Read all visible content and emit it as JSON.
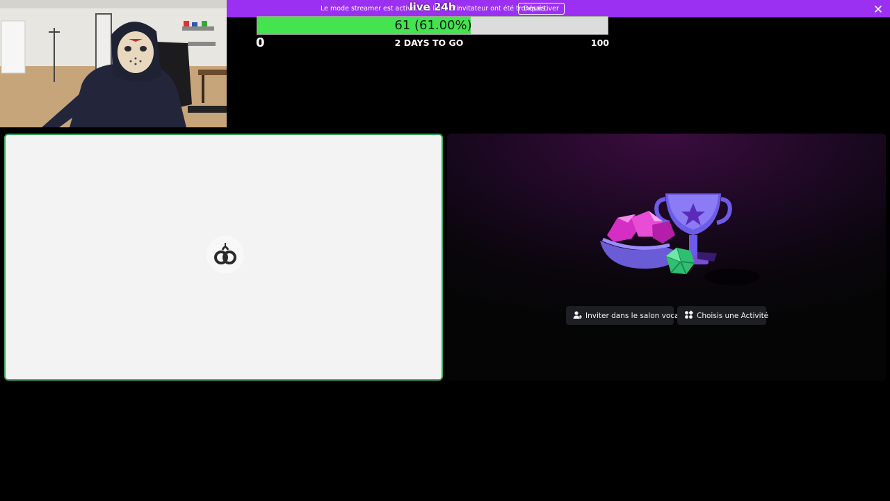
{
  "banner": {
    "text": "Le mode streamer est activé. Les liens d'invitateur ont été tronqués.",
    "disable_label": "Désactiver",
    "close_icon": "close-icon",
    "color": "#9b30f2"
  },
  "overlay": {
    "title": "live 24h",
    "progress": {
      "label": "61 (61.00%)",
      "value": 61,
      "fraction": 0.61,
      "min_label": "0",
      "max_label": "100",
      "countdown": "2 DAYS TO GO",
      "fill_color": "#44e34f"
    }
  },
  "webcam": {
    "description_icon": "webcam-feed"
  },
  "stage": {
    "left_tile": {
      "loader_icon": "loading-spinner-icon",
      "border_color": "#3ba55c"
    },
    "right_tile": {
      "art_icon": "activities-trophy-icon",
      "invite_label": "Inviter dans le salon vocal",
      "activity_label": "Choisis une Activité"
    }
  }
}
